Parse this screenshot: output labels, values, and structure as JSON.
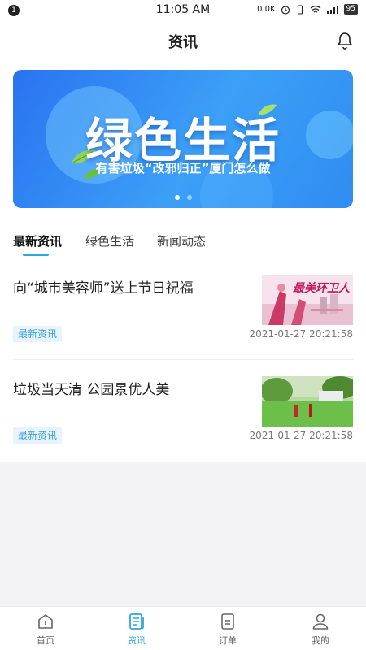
{
  "status_bar": {
    "notification_count": "1",
    "time": "11:05 AM",
    "network_speed": "0.0K",
    "battery": "95"
  },
  "header": {
    "title": "资讯",
    "bell_icon": "bell-icon"
  },
  "banner": {
    "headline": "绿色生活",
    "subline": "有害垃圾“改邪归正”厦门怎么做",
    "slide_count": 2,
    "active_slide": 1,
    "colors": {
      "start": "#2a73f0",
      "end": "#3ca0f7"
    }
  },
  "tabs": [
    {
      "label": "最新资讯",
      "active": true
    },
    {
      "label": "绿色生活",
      "active": false
    },
    {
      "label": "新闻动态",
      "active": false
    }
  ],
  "news": [
    {
      "title": "向“城市美容师”送上节日祝福",
      "badge": "最新资讯",
      "time": "2021-01-27 20:21:58",
      "thumb": "最美环卫人"
    },
    {
      "title": "垃圾当天清 公园景优人美",
      "badge": "最新资讯",
      "time": "2021-01-27 20:21:58",
      "thumb": ""
    }
  ],
  "bottom_nav": [
    {
      "label": "首页",
      "icon": "home-icon",
      "active": false
    },
    {
      "label": "资讯",
      "icon": "news-icon",
      "active": true
    },
    {
      "label": "订单",
      "icon": "order-icon",
      "active": false
    },
    {
      "label": "我的",
      "icon": "profile-icon",
      "active": false
    }
  ],
  "accent_color": "#2aa6e0"
}
